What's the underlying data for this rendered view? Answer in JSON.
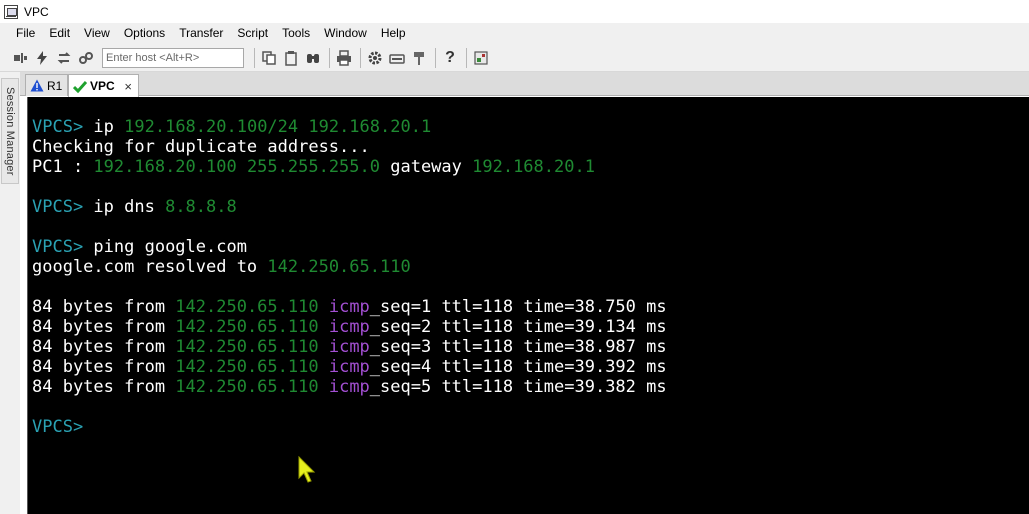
{
  "window": {
    "title": "VPC"
  },
  "menu": [
    "File",
    "Edit",
    "View",
    "Options",
    "Transfer",
    "Script",
    "Tools",
    "Window",
    "Help"
  ],
  "toolbar": {
    "host_placeholder": "Enter host <Alt+R>"
  },
  "session_manager": {
    "label": "Session Manager"
  },
  "tabs": [
    {
      "label": "R1",
      "status": "warning"
    },
    {
      "label": "VPC",
      "status": "connected",
      "close": "×"
    }
  ],
  "colors": {
    "prompt": "#2aa1b3",
    "ip": "#1f8a32",
    "icmp": "#a24fd2",
    "terminal_bg": "#000000",
    "cursor": "#e6f01e"
  },
  "terminal": {
    "lines": [
      {
        "segments": [
          {
            "t": "VPCS> ",
            "c": "prompt"
          },
          {
            "t": "ip ",
            "c": "white"
          },
          {
            "t": "192.168.20.100/24 192.168.20.1",
            "c": "green"
          }
        ]
      },
      {
        "segments": [
          {
            "t": "Checking for duplicate address...",
            "c": "white"
          }
        ]
      },
      {
        "segments": [
          {
            "t": "PC1 : ",
            "c": "white"
          },
          {
            "t": "192.168.20.100 255.255.255.0",
            "c": "green"
          },
          {
            "t": " gateway ",
            "c": "white"
          },
          {
            "t": "192.168.20.1",
            "c": "green"
          }
        ]
      },
      {
        "segments": []
      },
      {
        "segments": [
          {
            "t": "VPCS> ",
            "c": "prompt"
          },
          {
            "t": "ip dns ",
            "c": "white"
          },
          {
            "t": "8.8.8.8",
            "c": "green"
          }
        ]
      },
      {
        "segments": []
      },
      {
        "segments": [
          {
            "t": "VPCS> ",
            "c": "prompt"
          },
          {
            "t": "ping google.com",
            "c": "white"
          }
        ]
      },
      {
        "segments": [
          {
            "t": "google.com resolved to ",
            "c": "white"
          },
          {
            "t": "142.250.65.110",
            "c": "green"
          }
        ]
      },
      {
        "segments": []
      },
      {
        "segments": [
          {
            "t": "84 bytes from ",
            "c": "white"
          },
          {
            "t": "142.250.65.110",
            "c": "green"
          },
          {
            "t": " ",
            "c": "white"
          },
          {
            "t": "icmp",
            "c": "purple"
          },
          {
            "t": "_seq=1 ttl=118 time=38.750 ms",
            "c": "white"
          }
        ]
      },
      {
        "segments": [
          {
            "t": "84 bytes from ",
            "c": "white"
          },
          {
            "t": "142.250.65.110",
            "c": "green"
          },
          {
            "t": " ",
            "c": "white"
          },
          {
            "t": "icmp",
            "c": "purple"
          },
          {
            "t": "_seq=2 ttl=118 time=39.134 ms",
            "c": "white"
          }
        ]
      },
      {
        "segments": [
          {
            "t": "84 bytes from ",
            "c": "white"
          },
          {
            "t": "142.250.65.110",
            "c": "green"
          },
          {
            "t": " ",
            "c": "white"
          },
          {
            "t": "icmp",
            "c": "purple"
          },
          {
            "t": "_seq=3 ttl=118 time=38.987 ms",
            "c": "white"
          }
        ]
      },
      {
        "segments": [
          {
            "t": "84 bytes from ",
            "c": "white"
          },
          {
            "t": "142.250.65.110",
            "c": "green"
          },
          {
            "t": " ",
            "c": "white"
          },
          {
            "t": "icmp",
            "c": "purple"
          },
          {
            "t": "_seq=4 ttl=118 time=39.392 ms",
            "c": "white"
          }
        ]
      },
      {
        "segments": [
          {
            "t": "84 bytes from ",
            "c": "white"
          },
          {
            "t": "142.250.65.110",
            "c": "green"
          },
          {
            "t": " ",
            "c": "white"
          },
          {
            "t": "icmp",
            "c": "purple"
          },
          {
            "t": "_seq=5 ttl=118 time=39.382 ms",
            "c": "white"
          }
        ]
      },
      {
        "segments": []
      },
      {
        "segments": [
          {
            "t": "VPCS>",
            "c": "prompt"
          }
        ]
      }
    ]
  }
}
